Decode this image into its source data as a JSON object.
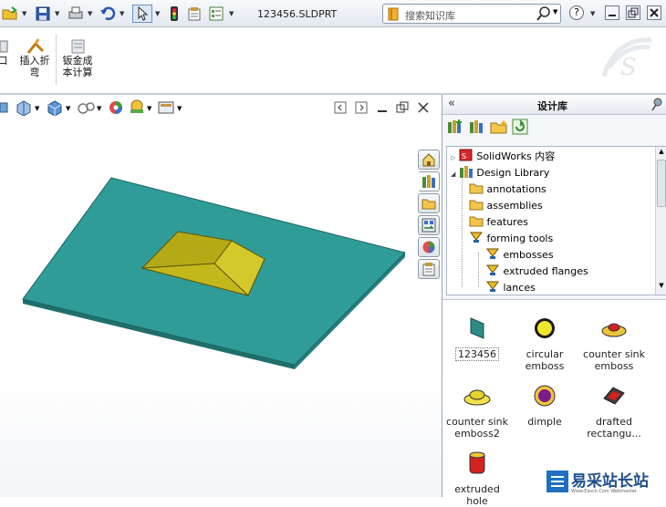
{
  "titlebar": {
    "title": "123456.SLDPRT",
    "search_placeholder": "搜索知识库",
    "help_label": "?"
  },
  "ribbon": {
    "partial_label": "口",
    "insert_bend_label": "插入折弯",
    "sheetmetal_cost_label": "钣金成本计算"
  },
  "panel": {
    "collapse_label": "«",
    "title": "设计库",
    "tree": [
      {
        "label": "SolidWorks 内容"
      },
      {
        "label": "Design Library"
      },
      {
        "label": "annotations"
      },
      {
        "label": "assemblies"
      },
      {
        "label": "features"
      },
      {
        "label": "forming tools"
      },
      {
        "label": "embosses"
      },
      {
        "label": "extruded flanges"
      },
      {
        "label": "lances"
      }
    ],
    "items": [
      {
        "label": "123456"
      },
      {
        "label": "circular emboss"
      },
      {
        "label": "counter sink emboss"
      },
      {
        "label": "counter sink emboss2"
      },
      {
        "label": "dimple"
      },
      {
        "label": "drafted rectangu..."
      },
      {
        "label": "extruded hole"
      }
    ]
  },
  "watermark": {
    "text": "易采站长站",
    "subtext": "Www.Easck.Com  Webmaster"
  },
  "colors": {
    "plate_top": "#2f9c98",
    "plate_edge": "#1f6f6c",
    "boss_top": "#b7ae18",
    "boss_side": "#d6cd2a",
    "boss_front": "#e01a12",
    "accent": "#3a6bb5"
  }
}
